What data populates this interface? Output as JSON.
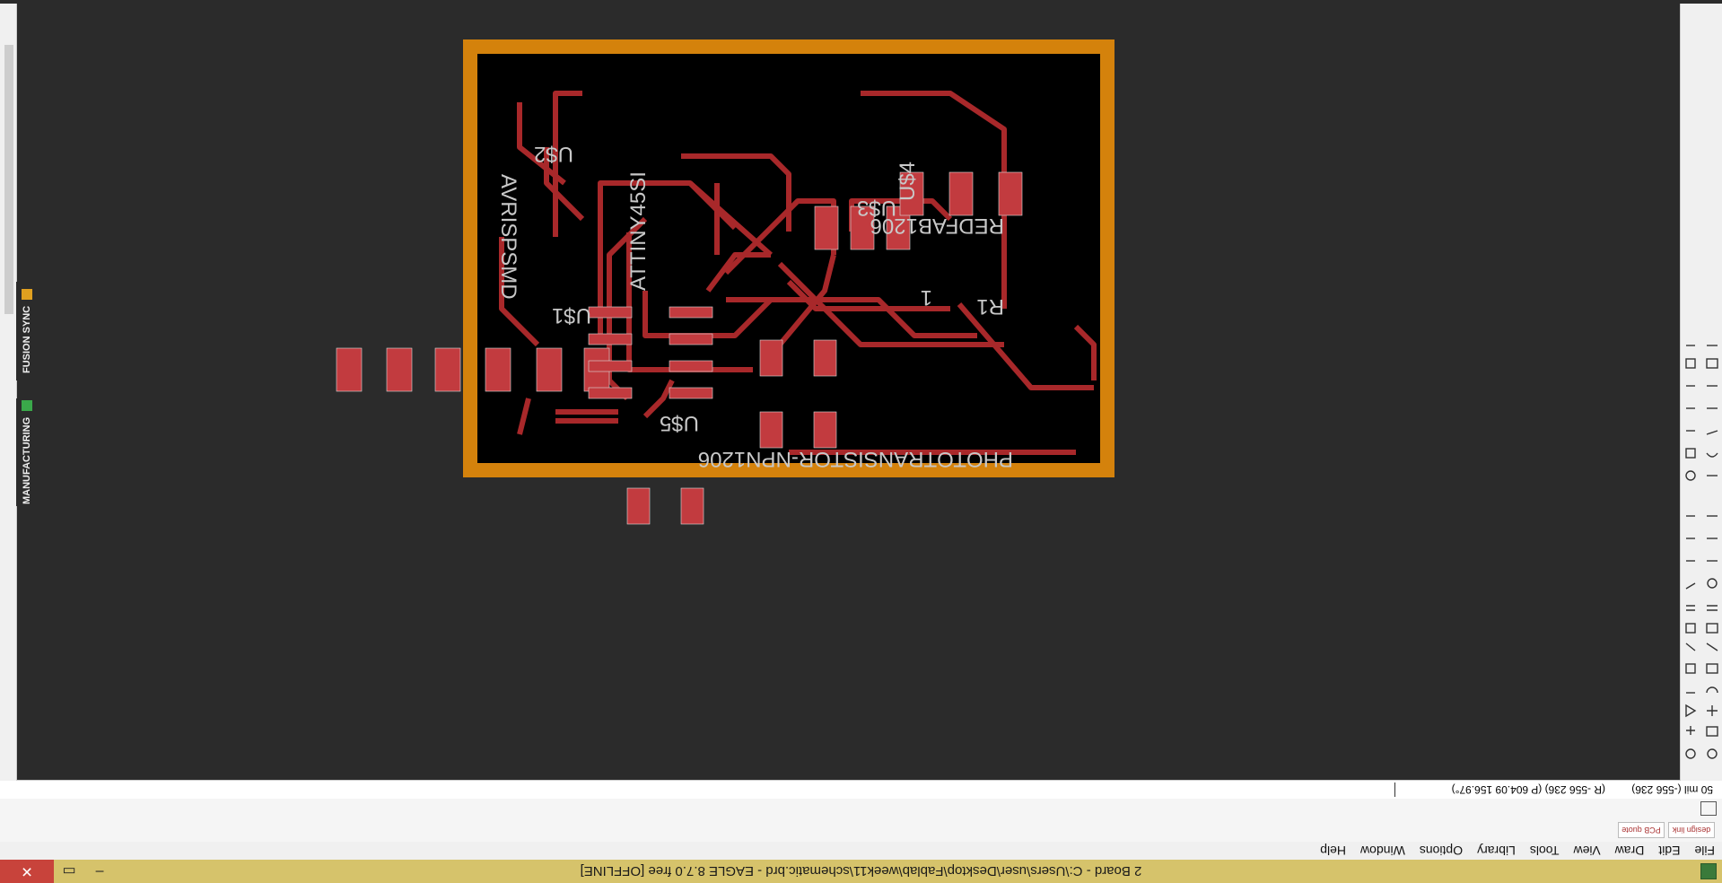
{
  "window": {
    "title": "2 Board - C:\\Users\\user\\Desktop\\Fablab\\week11\\schematic.brd - EAGLE 8.7.0 free [OFFLINE]",
    "minimize": "–",
    "close": "✕"
  },
  "menu": [
    "File",
    "Edit",
    "Draw",
    "View",
    "Tools",
    "Library",
    "Options",
    "Window",
    "Help"
  ],
  "toolbar_icons": [
    "design link",
    "PCB quote"
  ],
  "status": {
    "grid_coord": "50 mil (-556 236)",
    "pointer_coord": "(R -556 236) (P 604.09 156.97°)"
  },
  "side_tabs": [
    "FUSION SYNC",
    "MANUFACTURING"
  ],
  "board": {
    "labels": {
      "avrisp": "AVRISPSMD",
      "us4": "U$4",
      "one": "1",
      "us2": "U$2",
      "us1": "U$1",
      "attiny": "ATTINY45SI",
      "us3": "U$3",
      "r1": "R1",
      "redfab": "REDFAB1206",
      "us5": "U$5",
      "photo": "PHOTOTRANSISTOR-NPN1206"
    },
    "colors": {
      "outline": "#d4820c",
      "trace": "#a8282a",
      "pad": "#c23b3f",
      "silk": "#c8c8c8",
      "background": "#000000"
    }
  }
}
